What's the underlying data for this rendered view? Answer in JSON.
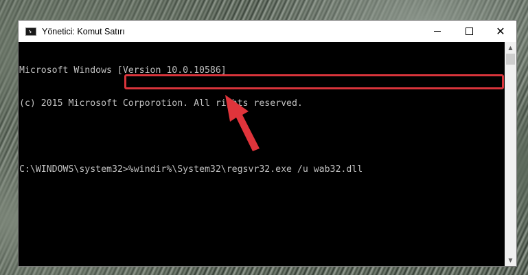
{
  "window": {
    "title": "Yönetici: Komut Satırı",
    "controls": {
      "minimize": "—",
      "maximize": "□",
      "close": "✕"
    }
  },
  "console": {
    "lines": [
      "Microsoft Windows [Version 10.0.10586]",
      "(c) 2015 Microsoft Corporotion. All rights reserved.",
      "",
      "C:\\WINDOWS\\system32>%windir%\\System32\\regsvr32.exe /u wab32.dll"
    ],
    "text_color": "#c0c0c0",
    "background": "#000000"
  },
  "annotation": {
    "highlight_color": "#d9343b",
    "arrow_color": "#e0343b",
    "icon": "arrow-pointer-icon"
  },
  "scrollbar": {
    "up_icon": "▲",
    "down_icon": "▼"
  }
}
